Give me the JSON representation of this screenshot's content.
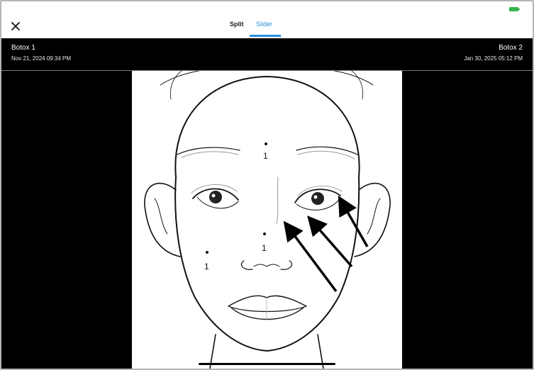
{
  "toolbar": {
    "close_icon": "close-icon",
    "battery_icon": "battery-icon",
    "tabs": [
      {
        "label": "Split",
        "active": false
      },
      {
        "label": "Slider",
        "active": true
      }
    ],
    "accent_color": "#2a8fd8"
  },
  "comparison": {
    "left": {
      "title": "Botox 1",
      "date": "Nov 21, 2024 09:34 PM"
    },
    "right": {
      "title": "Botox 2",
      "date": "Jan 30, 2025 05:12 PM"
    }
  },
  "face_chart": {
    "injection_points": [
      {
        "label": "1"
      },
      {
        "label": "1"
      },
      {
        "label": "1"
      }
    ]
  }
}
